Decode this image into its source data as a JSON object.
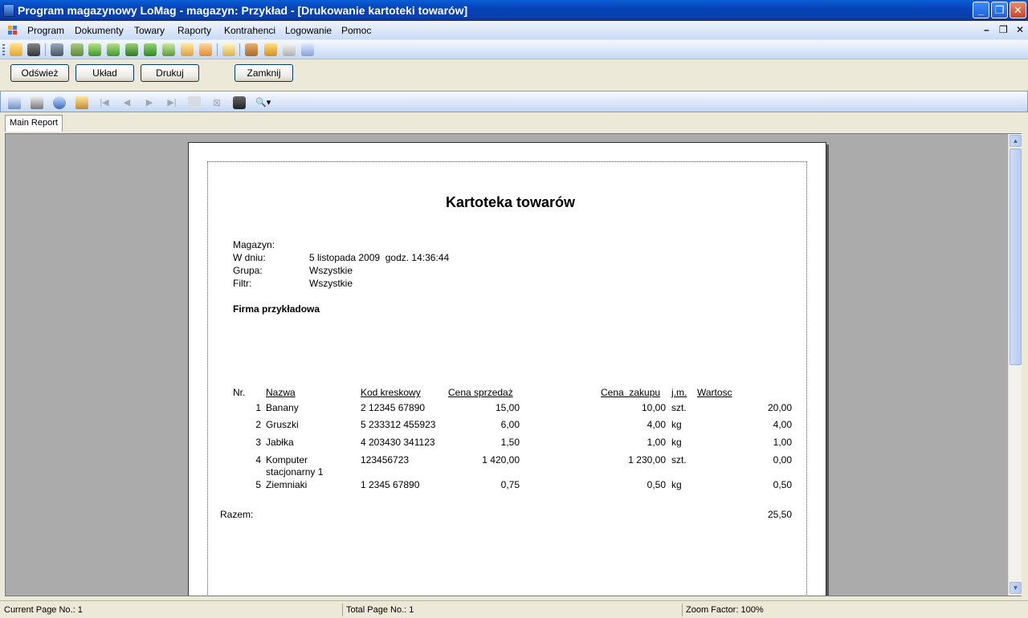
{
  "window": {
    "title": "Program magazynowy LoMag - magazyn: Przykład - [Drukowanie kartoteki towarów]"
  },
  "menu": [
    "Program",
    "Dokumenty",
    "Towary",
    "Raporty",
    "Kontrahenci",
    "Logowanie",
    "Pomoc"
  ],
  "buttons": {
    "refresh": "Odśwież",
    "layout": "Układ",
    "print": "Drukuj",
    "close": "Zamknij"
  },
  "tab": "Main Report",
  "report": {
    "title": "Kartoteka towarów",
    "meta": [
      {
        "label": "Magazyn:",
        "value": ""
      },
      {
        "label": "W dniu:",
        "value": "5 listopada 2009  godz. 14:36:44"
      },
      {
        "label": "Grupa:",
        "value": "Wszystkie"
      },
      {
        "label": "Filtr:",
        "value": "Wszystkie"
      }
    ],
    "company": "Firma przykładowa",
    "headers": {
      "nr": "Nr.",
      "name": "Nazwa",
      "barcode": "Kod kreskowy",
      "sale_price": "Cena sprzedaż",
      "buy_price": "Cena  zakupu",
      "unit": "j.m.",
      "value": "Wartosc"
    },
    "rows": [
      {
        "nr": "1",
        "name": "Banany",
        "name2": "",
        "barcode": "2 12345 67890",
        "sale": "15,00",
        "buy": "10,00",
        "unit": "szt.",
        "value": "20,00"
      },
      {
        "nr": "2",
        "name": "Gruszki",
        "name2": "",
        "barcode": "5 233312 455923",
        "sale": "6,00",
        "buy": "4,00",
        "unit": "kg",
        "value": "4,00"
      },
      {
        "nr": "3",
        "name": "Jabłka",
        "name2": "",
        "barcode": "4 203430 341123",
        "sale": "1,50",
        "buy": "1,00",
        "unit": "kg",
        "value": "1,00"
      },
      {
        "nr": "4",
        "name": "Komputer",
        "name2": "stacjonarny 1",
        "barcode": "123456723",
        "sale": "1 420,00",
        "buy": "1 230,00",
        "unit": "szt.",
        "value": "0,00"
      },
      {
        "nr": "5",
        "name": "Ziemniaki",
        "name2": "",
        "barcode": "1 2345 67890",
        "sale": "0,75",
        "buy": "0,50",
        "unit": "kg",
        "value": "0,50"
      }
    ],
    "total_label": "Razem:",
    "total_value": "25,50"
  },
  "status": {
    "current_page": "Current Page No.: 1",
    "total_page": "Total Page No.: 1",
    "zoom": "Zoom Factor: 100%"
  }
}
